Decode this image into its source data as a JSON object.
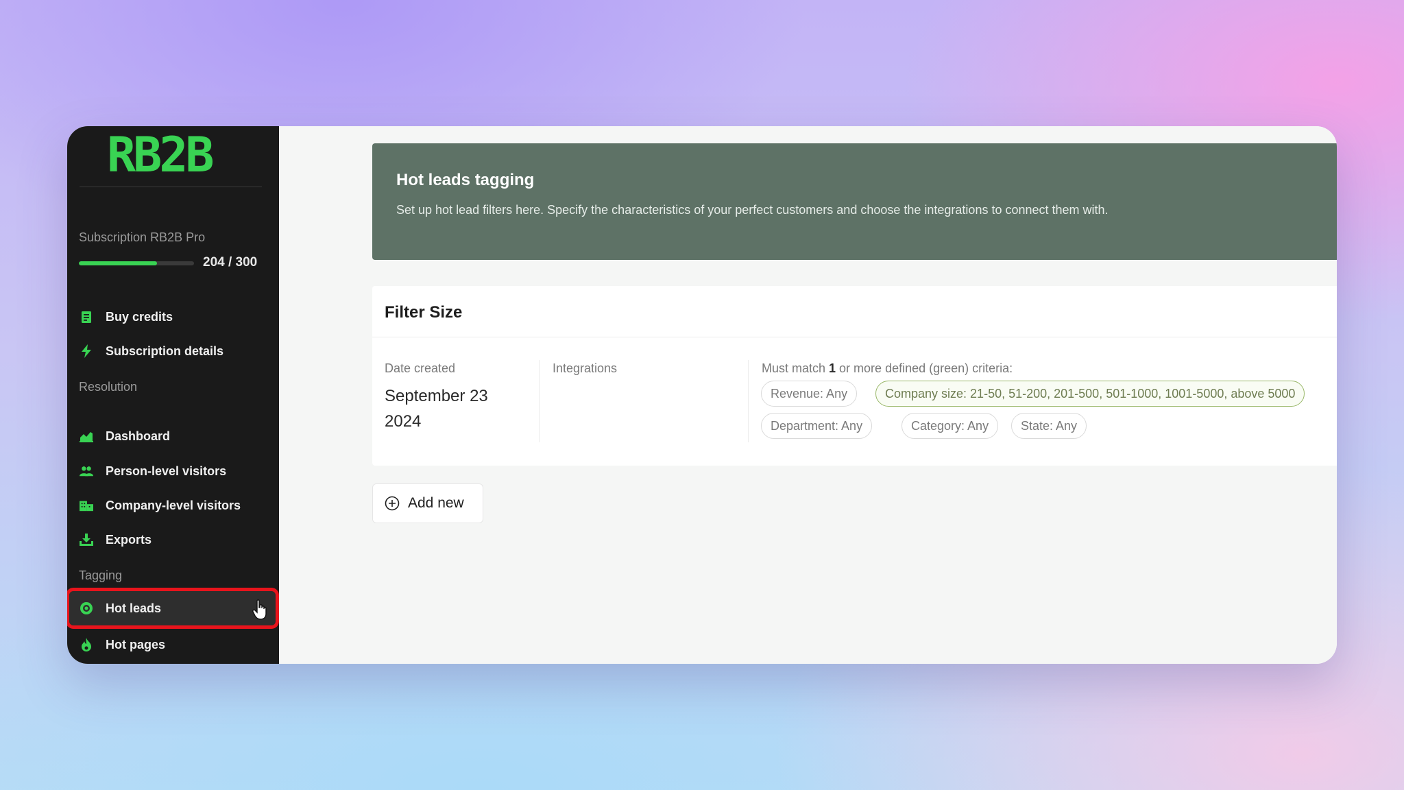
{
  "app": {
    "logo_text": "RB2B",
    "brand_green": "#39d353"
  },
  "sidebar": {
    "subscription_label": "Subscription RB2B Pro",
    "credits_used": 204,
    "credits_total": 300,
    "credits_text": "204 / 300",
    "account_items": [
      {
        "label": "Buy credits",
        "icon": "receipt-icon"
      },
      {
        "label": "Subscription details",
        "icon": "lightning-icon"
      }
    ],
    "resolution_label": "Resolution",
    "resolution_items": [
      {
        "label": "Dashboard",
        "icon": "chart-icon"
      },
      {
        "label": "Person-level visitors",
        "icon": "people-icon"
      },
      {
        "label": "Company-level visitors",
        "icon": "building-icon"
      },
      {
        "label": "Exports",
        "icon": "download-icon"
      }
    ],
    "tagging_label": "Tagging",
    "tagging_items": [
      {
        "label": "Hot leads",
        "icon": "target-icon",
        "active": true
      },
      {
        "label": "Hot pages",
        "icon": "flame-icon"
      }
    ]
  },
  "banner": {
    "title": "Hot leads tagging",
    "description": "Set up hot lead filters here. Specify the characteristics of your perfect customers and choose the integrations to connect them with."
  },
  "filter_card": {
    "title": "Filter Size",
    "date_label": "Date created",
    "date_value": "September 23 2024",
    "integrations_label": "Integrations",
    "criteria_prefix": "Must match ",
    "criteria_count": "1",
    "criteria_suffix": " or more defined (green) criteria:",
    "chips": [
      {
        "label": "Revenue: Any",
        "active": false
      },
      {
        "label": "Company size: 21-50, 51-200, 201-500, 501-1000, 1001-5000, above 5000",
        "active": true
      },
      {
        "label": "Department: Any",
        "active": false
      },
      {
        "label": "Category: Any",
        "active": false
      },
      {
        "label": "State: Any",
        "active": false
      }
    ]
  },
  "add_new_label": "Add new"
}
